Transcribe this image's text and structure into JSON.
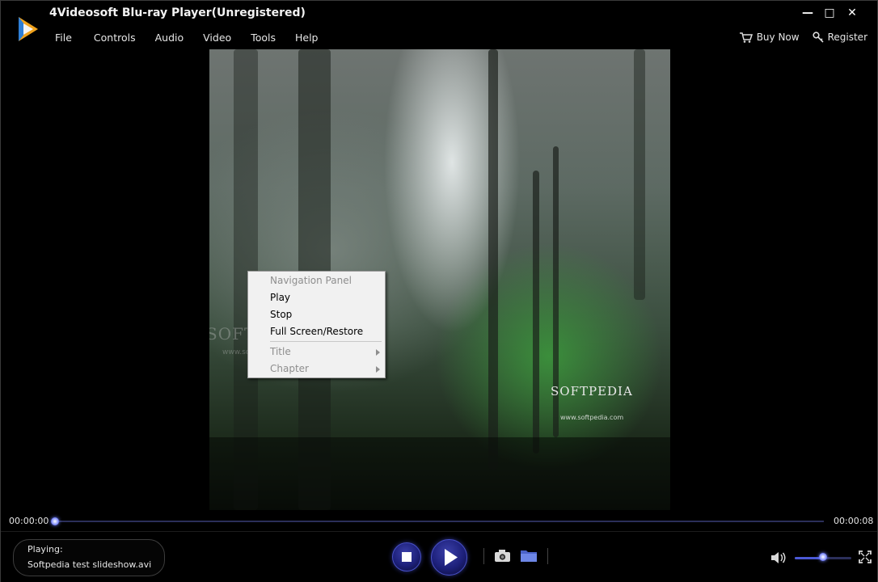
{
  "window": {
    "title": "4Videosoft Blu-ray Player(Unregistered)",
    "minimize_glyph": "—",
    "maximize_glyph": "□",
    "close_glyph": "✕"
  },
  "menu": [
    "File",
    "Controls",
    "Audio",
    "Video",
    "Tools",
    "Help"
  ],
  "links": {
    "buy_now": "Buy Now",
    "register": "Register"
  },
  "video": {
    "watermark_big": "SOFTPEDIA",
    "watermark_small": "www.softpedia.com",
    "ghost_big": "SOFTPEDIA",
    "ghost_small": "www.softpedia.com"
  },
  "context_menu": {
    "items": [
      {
        "label": "Navigation Panel",
        "enabled": false
      },
      {
        "label": "Play",
        "enabled": true
      },
      {
        "label": "Stop",
        "enabled": true
      },
      {
        "label": "Full Screen/Restore",
        "enabled": true
      },
      {
        "label": "Title",
        "enabled": false,
        "submenu": true
      },
      {
        "label": "Chapter",
        "enabled": false,
        "submenu": true
      }
    ]
  },
  "playback": {
    "current_time": "00:00:00",
    "total_time": "00:00:08",
    "progress_fraction": 0.0
  },
  "status": {
    "label": "Playing:",
    "file": "Softpedia test slideshow.avi"
  },
  "volume": {
    "level_fraction": 0.5
  },
  "colors": {
    "accent": "#4850c8",
    "track": "#2b2f5a"
  },
  "icons": [
    "stop-icon",
    "play-icon",
    "camera-icon",
    "folder-icon",
    "volume-icon",
    "fullscreen-icon",
    "cart-icon",
    "key-icon"
  ]
}
